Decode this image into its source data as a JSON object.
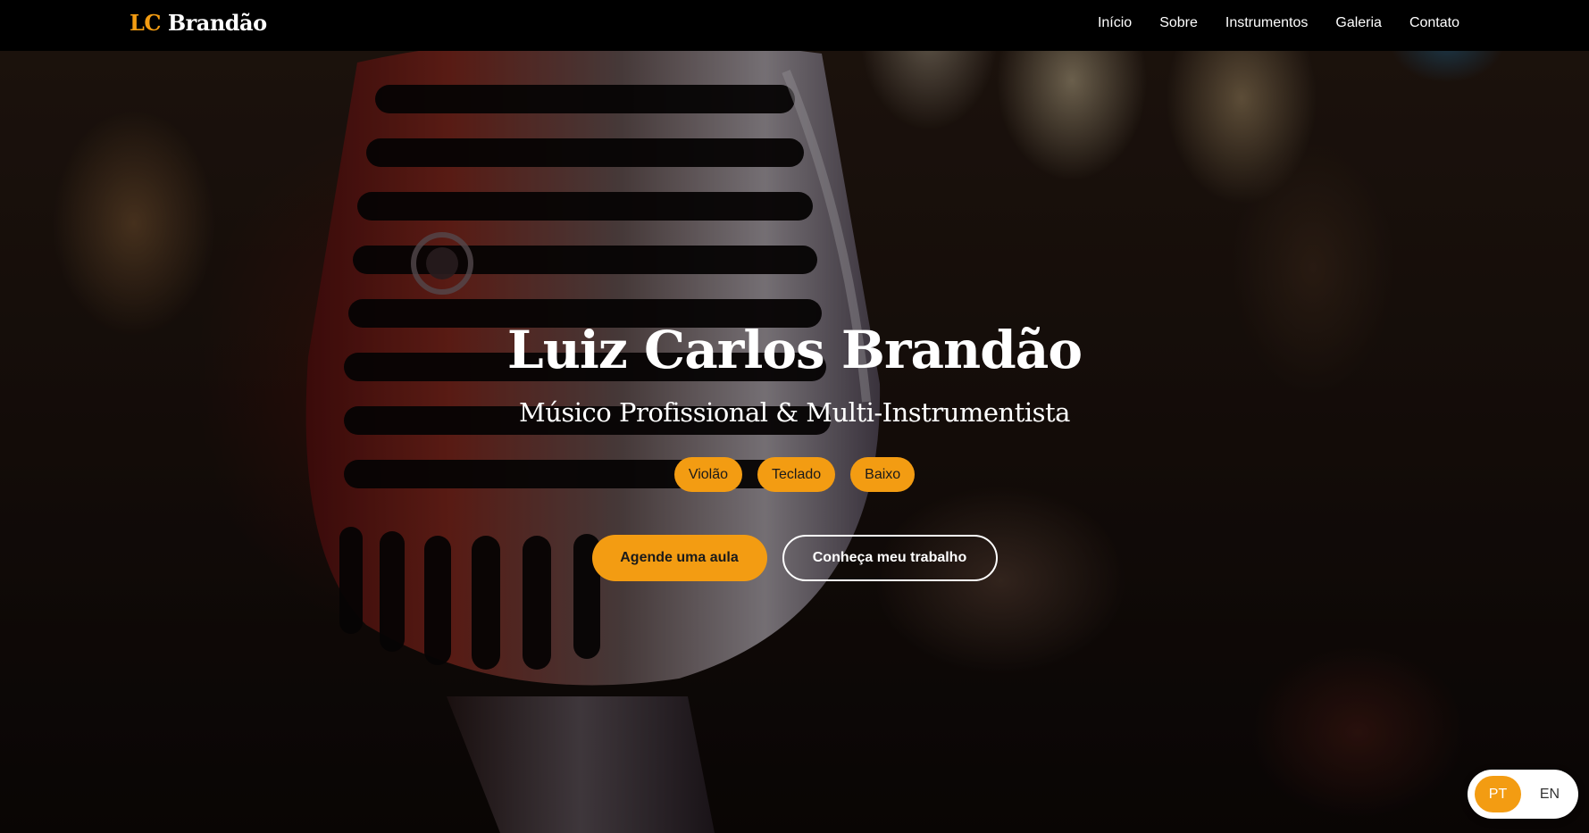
{
  "brand": {
    "prefix": "LC",
    "name": "Brandão"
  },
  "nav": {
    "items": [
      {
        "label": "Início"
      },
      {
        "label": "Sobre"
      },
      {
        "label": "Instrumentos"
      },
      {
        "label": "Galeria"
      },
      {
        "label": "Contato"
      }
    ]
  },
  "hero": {
    "title": "Luiz Carlos Brandão",
    "subtitle": "Músico Profissional & Multi-Instrumentista",
    "tags": [
      "Violão",
      "Teclado",
      "Baixo"
    ],
    "primary_cta": "Agende uma aula",
    "secondary_cta": "Conheça meu trabalho"
  },
  "language_switch": {
    "options": [
      "PT",
      "EN"
    ],
    "active": "PT"
  },
  "colors": {
    "accent": "#f39c12",
    "navbar_bg": "#000000",
    "text": "#ffffff"
  }
}
